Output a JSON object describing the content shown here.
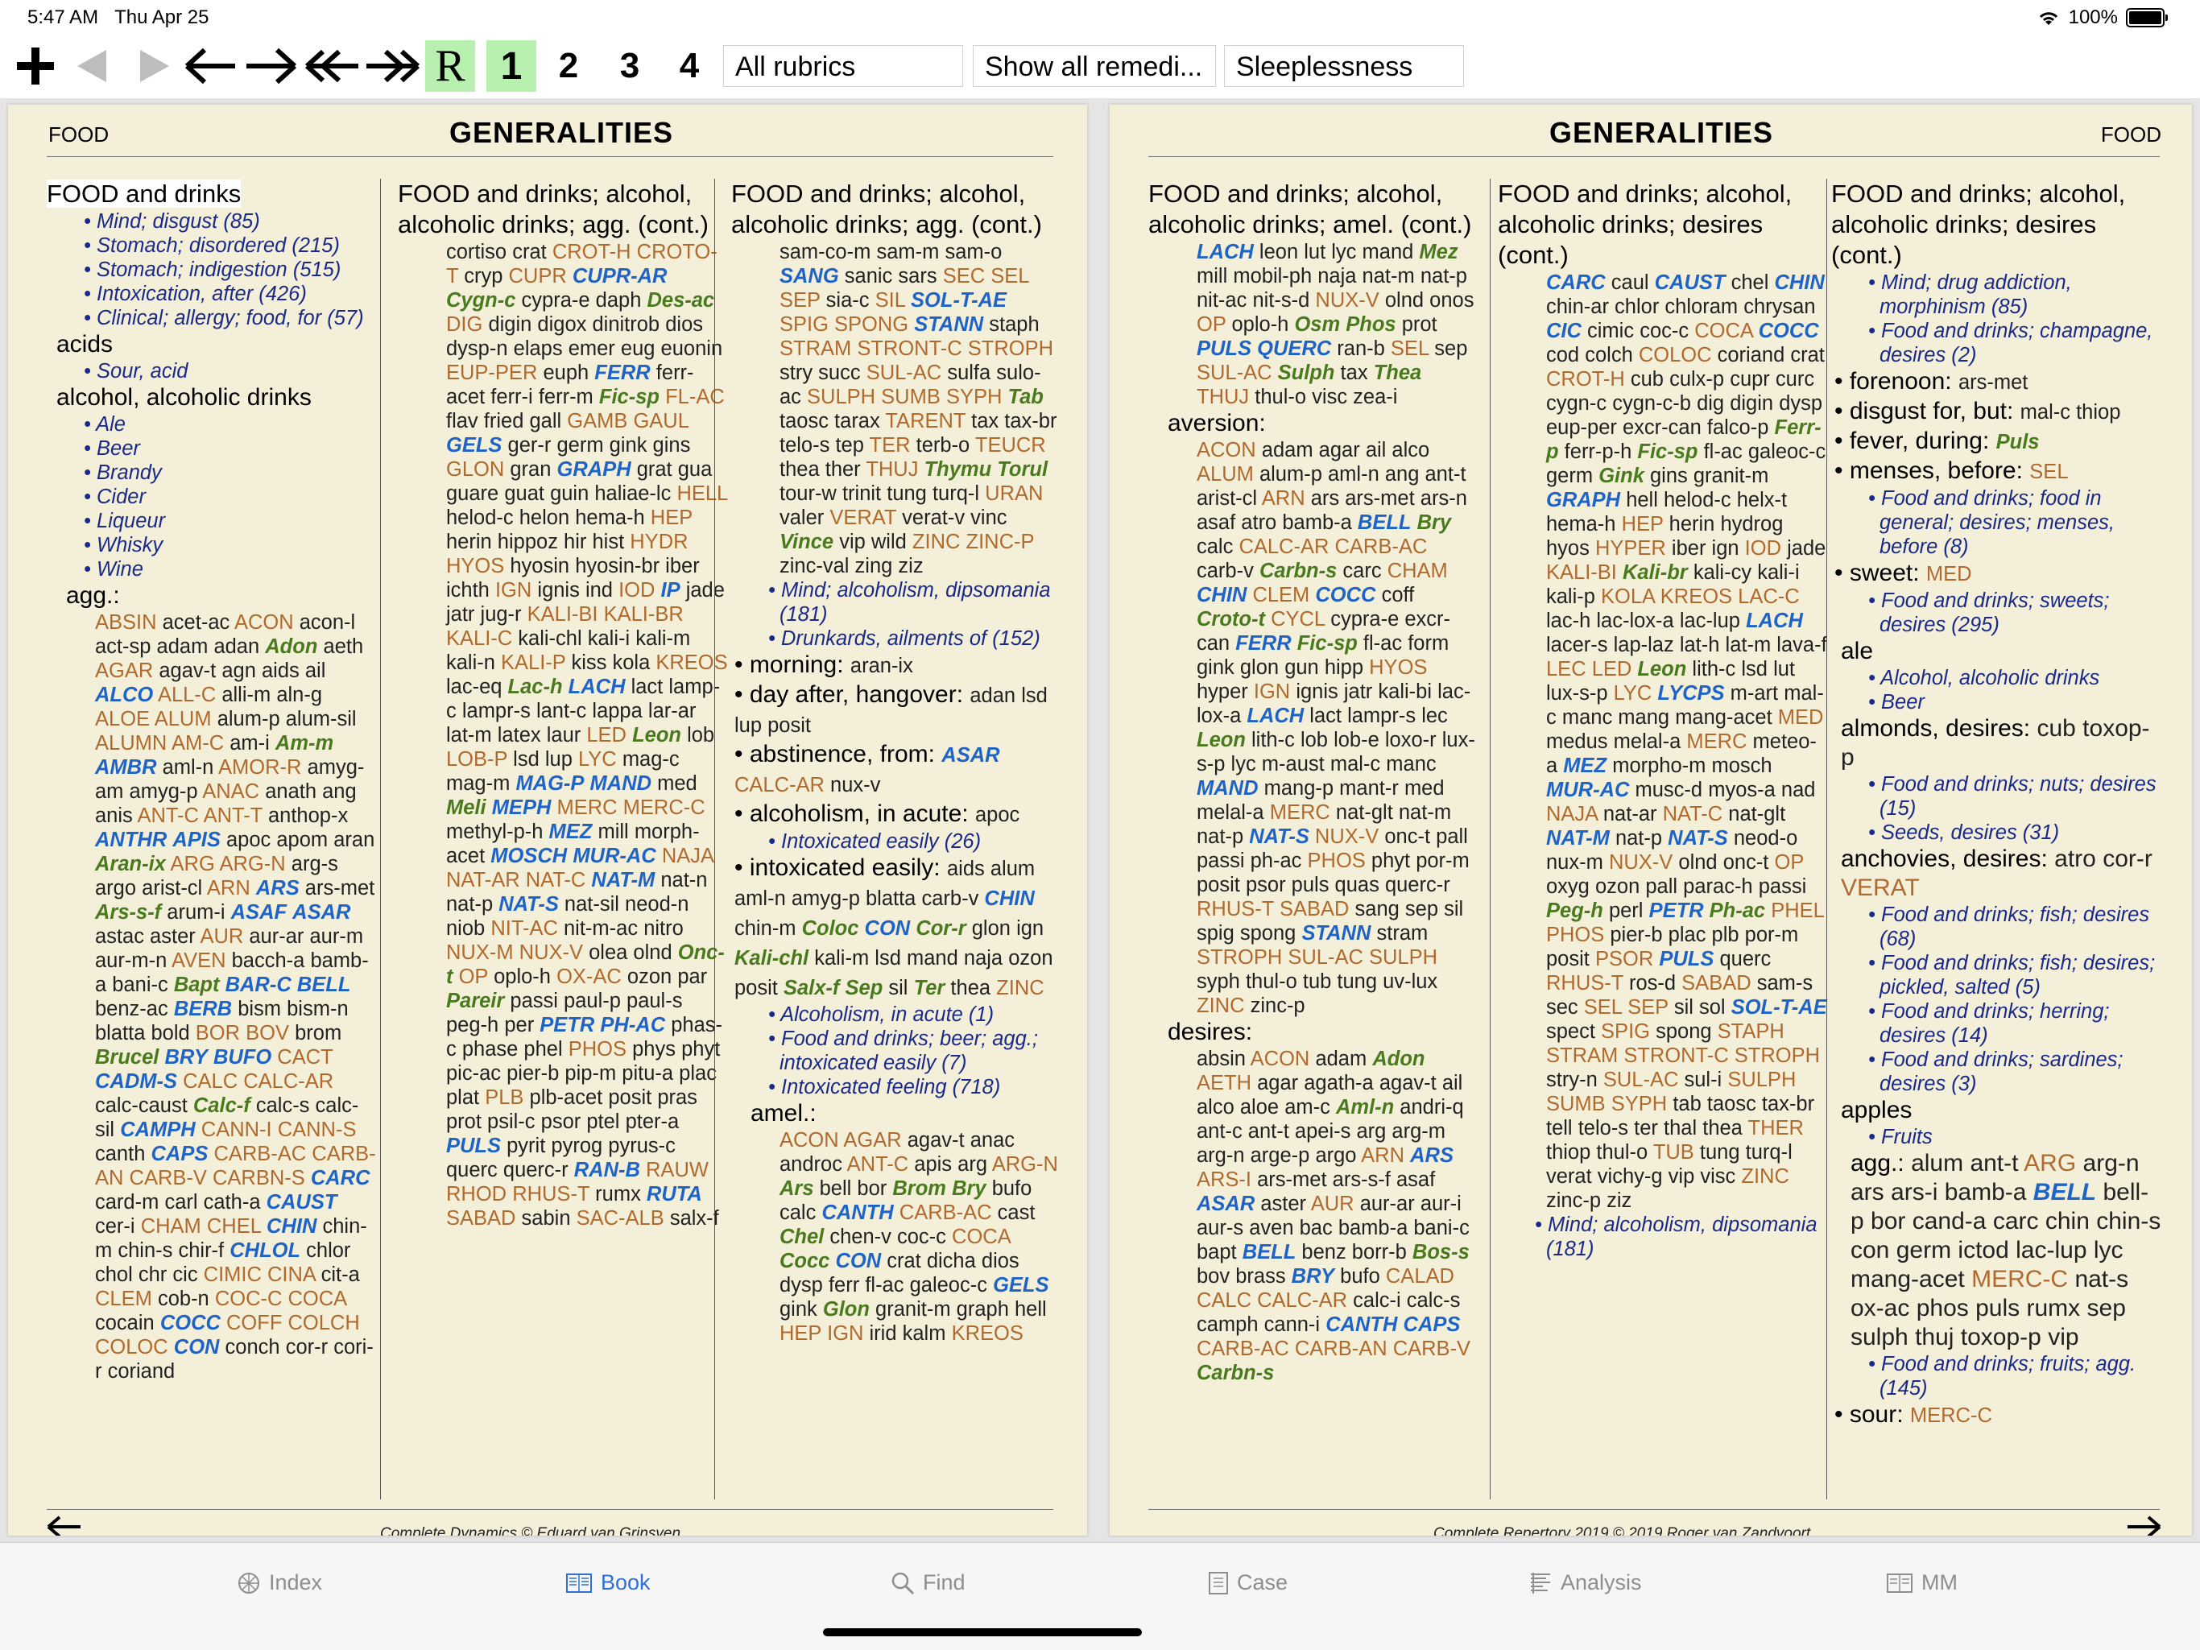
{
  "status": {
    "time": "5:47 AM",
    "date": "Thu Apr 25",
    "battery": "100%"
  },
  "toolbar": {
    "buttons": [
      "R",
      "1",
      "2",
      "3",
      "4"
    ],
    "filter_rubrics": "All rubrics",
    "filter_remedies": "Show all remedi...",
    "search_field": "Sleeplessness"
  },
  "left_page": {
    "running_head": "FOOD",
    "title": "GENERALITIES",
    "footer": "Complete Dynamics © Eduard van Grinsven",
    "col1": [
      {
        "k": "h",
        "t": "FOOD and drinks",
        "hl": true
      },
      {
        "k": "x",
        "t": "Mind; disgust (85)"
      },
      {
        "k": "x",
        "t": "Stomach; disordered (215)"
      },
      {
        "k": "x",
        "t": "Stomach; indigestion (515)"
      },
      {
        "k": "x",
        "t": "Intoxication, after (426)"
      },
      {
        "k": "x",
        "t": "Clinical; allergy; food, for (57)"
      },
      {
        "k": "s",
        "t": "acids"
      },
      {
        "k": "x",
        "t": "Sour, acid"
      },
      {
        "k": "s",
        "t": "alcohol, alcoholic drinks"
      },
      {
        "k": "x",
        "t": "Ale"
      },
      {
        "k": "x",
        "t": "Beer"
      },
      {
        "k": "x",
        "t": "Brandy"
      },
      {
        "k": "x",
        "t": "Cider"
      },
      {
        "k": "x",
        "t": "Liqueur"
      },
      {
        "k": "x",
        "t": "Whisky"
      },
      {
        "k": "x",
        "t": "Wine"
      },
      {
        "k": "s2",
        "t": "agg.: "
      },
      {
        "k": "r",
        "t": "ABSIN acet-ac ACON acon-l act-sp adam adan Adon aeth AGAR agav-t agn aids ail ALCO ALL-C alli-m aln-g ALOE ALUM alum-p alum-sil ALUMN AM-C am-i Am-m AMBR aml-n AMOR-R amyg-am amyg-p ANAC anath ang anis ANT-C ANT-T anthop-x ANTHR APIS apoc apom aran Aran-ix ARG ARG-N arg-s argo arist-cl ARN ARS ars-met Ars-s-f arum-i ASAF ASAR astac aster AUR aur-ar aur-m aur-m-n AVEN bacch-a bamb-a bani-c Bapt BAR-C BELL benz-ac BERB bism bism-n blatta bold BOR BOV brom Brucel BRY BUFO CACT CADM-S CALC CALC-AR calc-caust Calc-f calc-s calc-sil CAMPH CANN-I CANN-S canth CAPS CARB-AC CARB-AN CARB-V CARBN-S CARC card-m carl cath-a CAUST cer-i CHAM CHEL CHIN chin-m chin-s chir-f CHLOL chlor chol chr cic CIMIC CINA cit-a CLEM cob-n COC-C COCA cocain COCC COFF COLCH COLOC CON conch cor-r cori-r coriand"
      }
    ],
    "col2": [
      {
        "k": "h",
        "t": "FOOD and drinks; alcohol, alcoholic drinks; agg. (cont.)"
      },
      {
        "k": "r",
        "t": "cortiso crat CROT-H CROTO-T cryp CUPR CUPR-AR Cygn-c cypra-e daph Des-ac DIG digin digox dinitrob dios dysp-n elaps emer eug euonin EUP-PER euph FERR ferr-acet ferr-i ferr-m Fic-sp FL-AC flav fried gall GAMB GAUL GELS ger-r germ gink gins GLON gran GRAPH grat gua guare guat guin haliae-lc HELL helod-c helon hema-h HEP herin hippoz hir hist HYDR HYOS hyosin hyosin-br iber ichth IGN ignis ind IOD IP jade jatr jug-r KALI-BI KALI-BR KALI-C kali-chl kali-i kali-m kali-n KALI-P kiss kola KREOS lac-eq Lac-h LACH lact lamp-c lampr-s lant-c lappa lar-ar lat-m latex laur LED Leon lob LOB-P lsd lup LYC mag-c mag-m MAG-P MAND med Meli MEPH MERC MERC-C methyl-p-h MEZ mill morph-acet MOSCH MUR-AC NAJA NAT-AR NAT-C NAT-M nat-n nat-p NAT-S nat-sil neod-n niob NIT-AC nit-m-ac nitro NUX-M NUX-V olea olnd Onc-t OP oplo-h OX-AC ozon par Pareir passi paul-p paul-s peg-h per PETR PH-AC phas-c phase phel PHOS phys phyt pic-ac pier-b pip-m pitu-a plac plat PLB plb-acet posit pras prot psil-c psor ptel pter-a PULS pyrit pyrog pyrus-c querc querc-r RAN-B RAUW RHOD RHUS-T rumx RUTA SABAD sabin SAC-ALB salx-f"
      }
    ],
    "col3": [
      {
        "k": "h",
        "t": "FOOD and drinks; alcohol, alcoholic drinks; agg. (cont.)"
      },
      {
        "k": "r",
        "t": "sam-co-m sam-m sam-o SANG sanic sars SEC SEL SEP sia-c SIL SOL-T-AE SPIG SPONG STANN staph STRAM STRONT-C STROPH stry succ SUL-AC sulfa sulo-ac SULPH SUMB SYPH Tab taosc tarax TARENT tax tax-br telo-s tep TER terb-o TEUCR thea ther THUJ Thymu Torul tour-w trinit tung turq-l URAN valer VERAT verat-v vinc Vince vip wild ZINC ZINC-P zinc-val zing ziz"
      },
      {
        "k": "x",
        "t": "Mind; alcoholism, dipsomania (181)"
      },
      {
        "k": "x",
        "t": "Drunkards, ailments of (152)"
      },
      {
        "k": "b",
        "t": "morning: ",
        "r": "aran-ix"
      },
      {
        "k": "b",
        "t": "day after, hangover: ",
        "r": "adan lsd lup posit"
      },
      {
        "k": "b",
        "t": "abstinence, from: ",
        "r": "ASAR CALC-AR nux-v"
      },
      {
        "k": "b",
        "t": "alcoholism, in acute: ",
        "r": "apoc"
      },
      {
        "k": "x",
        "t": "Intoxicated easily (26)"
      },
      {
        "k": "b",
        "t": "intoxicated easily: ",
        "r": "aids alum aml-n amyg-p blatta carb-v CHIN chin-m Coloc CON Cor-r glon ign Kali-chl kali-m lsd mand naja ozon posit Salx-f Sep sil Ter thea ZINC"
      },
      {
        "k": "x",
        "t": "Alcoholism, in acute (1)"
      },
      {
        "k": "x",
        "t": "Food and drinks; beer; agg.; intoxicated easily (7)"
      },
      {
        "k": "x",
        "t": "Intoxicated feeling (718)"
      },
      {
        "k": "s2",
        "t": "amel.: "
      },
      {
        "k": "r",
        "t": "ACON AGAR agav-t anac androc ANT-C apis arg ARG-N Ars bell bor Brom Bry bufo calc CANTH CARB-AC cast Chel chen-v coc-c COCA Cocc CON crat dicha dios dysp ferr fl-ac galeoc-c GELS gink Glon granit-m graph hell HEP IGN irid kalm KREOS"
      }
    ]
  },
  "right_page": {
    "running_head": "FOOD",
    "title": "GENERALITIES",
    "footer": "Complete Repertory 2019 © 2019 Roger van Zandvoort",
    "col1": [
      {
        "k": "h",
        "t": "FOOD and drinks; alcohol, alcoholic drinks; amel. (cont.)"
      },
      {
        "k": "r",
        "t": "LACH leon lut lyc mand Mez mill mobil-ph naja nat-m nat-p nit-ac nit-s-d NUX-V olnd onos OP oplo-h Osm Phos prot PULS QUERC ran-b SEL sep SUL-AC Sulph tax Thea THUJ thul-o visc zea-i"
      },
      {
        "k": "s2",
        "t": "aversion: "
      },
      {
        "k": "r",
        "t": "ACON adam agar ail alco ALUM alum-p aml-n ang ant-t arist-cl ARN ars ars-met ars-n asaf atro bamb-a BELL Bry calc CALC-AR CARB-AC carb-v Carbn-s carc CHAM CHIN CLEM COCC coff Croto-t CYCL cypra-e excr-can FERR Fic-sp fl-ac form gink glon gun hipp HYOS hyper IGN ignis jatr kali-bi lac-lox-a LACH lact lampr-s lec Leon lith-c lob lob-e loxo-r lux-s-p lyc m-aust mal-c manc MAND mang-p mant-r med melal-a MERC nat-glt nat-m nat-p NAT-S NUX-V onc-t pall passi ph-ac PHOS phyt por-m posit psor puls quas querc-r RHUS-T SABAD sang sep sil spig spong STANN stram STROPH SUL-AC SULPH syph thul-o tub tung uv-lux ZINC zinc-p"
      },
      {
        "k": "s2",
        "t": "desires: "
      },
      {
        "k": "r",
        "t": "absin ACON adam Adon AETH agar agath-a agav-t ail alco aloe am-c Aml-n andri-q ant-c ant-t apei-s arg arg-m arg-n arge-p argo ARN ARS ARS-I ars-met ars-s-f asaf ASAR aster AUR aur-ar aur-i aur-s aven bac bamb-a bani-c bapt BELL benz borr-b Bos-s bov brass BRY bufo CALAD CALC CALC-AR calc-i calc-s camph cann-i CANTH CAPS CARB-AC CARB-AN CARB-V Carbn-s"
      }
    ],
    "col2": [
      {
        "k": "h",
        "t": "FOOD and drinks; alcohol, alcoholic drinks; desires (cont.)"
      },
      {
        "k": "r",
        "t": "CARC caul CAUST chel CHIN chin-ar chlor chloram chrysan CIC cimic coc-c COCA COCC cod colch COLOC coriand crat CROT-H cub culx-p cupr curc cygn-c cygn-c-b dig digin dysp eup-per excr-can falco-p Ferr-p ferr-p-h Fic-sp fl-ac galeoc-c germ Gink gins granit-m GRAPH hell helod-c helx-t hema-h HEP herin hydrog hyos HYPER iber ign IOD jade KALI-BI Kali-br kali-cy kali-i kali-p KOLA KREOS LAC-C lac-h lac-lox-a lac-lup LACH lacer-s lap-laz lat-h lat-m lava-f LEC LED Leon lith-c lsd lut lux-s-p LYC LYCPS m-art mal-c manc mang mang-acet MED medus melal-a MERC meteo-a MEZ morpho-m mosch MUR-AC musc-d myos-a nad NAJA nat-ar NAT-C nat-glt NAT-M nat-p NAT-S neod-o nux-m NUX-V olnd onc-t OP oxyg ozon pall parac-h passi Peg-h perl PETR Ph-ac PHEL PHOS pier-b plac plb por-m posit PSOR PULS querc RHUS-T ros-d SABAD sam-s sec SEL SEP sil sol SOL-T-AE spect SPIG spong STAPH STRAM STRONT-C STROPH stry-n SUL-AC sul-i SULPH SUMB SYPH tab taosc tax-br tell telo-s ter thal thea THER thiop thul-o TUB tung turq-l verat vichy-g vip visc ZINC zinc-p ziz"
      },
      {
        "k": "x",
        "t": "Mind; alcoholism, dipsomania (181)"
      }
    ],
    "col3": [
      {
        "k": "h",
        "t": "FOOD and drinks; alcohol, alcoholic drinks; desires (cont.)"
      },
      {
        "k": "x",
        "t": "Mind; drug addiction, morphinism (85)"
      },
      {
        "k": "x",
        "t": "Food and drinks; champagne, desires (2)"
      },
      {
        "k": "b",
        "t": "forenoon: ",
        "r": "ars-met"
      },
      {
        "k": "b",
        "t": "disgust for, but: ",
        "r": "mal-c thiop"
      },
      {
        "k": "b",
        "t": "fever, during: ",
        "r": "Puls"
      },
      {
        "k": "b",
        "t": "menses, before: ",
        "r": "SEL"
      },
      {
        "k": "x",
        "t": "Food and drinks; food in general; desires; menses, before (8)"
      },
      {
        "k": "b",
        "t": "sweet: ",
        "r": "MED"
      },
      {
        "k": "x",
        "t": "Food and drinks; sweets; desires (295)"
      },
      {
        "k": "s",
        "t": "ale"
      },
      {
        "k": "x",
        "t": "Alcohol, alcoholic drinks"
      },
      {
        "k": "x",
        "t": "Beer"
      },
      {
        "k": "s",
        "t": "almonds, desires: ",
        "r": "cub toxop-p"
      },
      {
        "k": "x",
        "t": "Food and drinks; nuts; desires (15)"
      },
      {
        "k": "x",
        "t": "Seeds, desires (31)"
      },
      {
        "k": "s",
        "t": "anchovies, desires: ",
        "r": "atro cor-r VERAT"
      },
      {
        "k": "x",
        "t": "Food and drinks; fish; desires (68)"
      },
      {
        "k": "x",
        "t": "Food and drinks; fish; desires; pickled, salted (5)"
      },
      {
        "k": "x",
        "t": "Food and drinks; herring; desires (14)"
      },
      {
        "k": "x",
        "t": "Food and drinks; sardines; desires (3)"
      },
      {
        "k": "s",
        "t": "apples"
      },
      {
        "k": "x",
        "t": "Fruits"
      },
      {
        "k": "s2",
        "t": "agg.: ",
        "r": "alum ant-t ARG arg-n ars ars-i bamb-a BELL bell-p bor cand-a carc chin chin-s con germ ictod lac-lup lyc mang-acet MERC-C nat-s ox-ac phos puls rumx sep sulph thuj toxop-p vip"
      },
      {
        "k": "x",
        "t": "Food and drinks; fruits; agg. (145)"
      },
      {
        "k": "b",
        "t": "sour: ",
        "r": "MERC-C"
      }
    ]
  },
  "grade_colors": {
    "r1": "#222222",
    "r2": "#b06a2e",
    "r3": "#1e64c8",
    "r4": "#4a7a1e"
  },
  "tabs": [
    {
      "label": "Index",
      "icon": "index-icon",
      "active": false
    },
    {
      "label": "Book",
      "icon": "book-icon",
      "active": true
    },
    {
      "label": "Find",
      "icon": "search-icon",
      "active": false
    },
    {
      "label": "Case",
      "icon": "case-icon",
      "active": false
    },
    {
      "label": "Analysis",
      "icon": "analysis-icon",
      "active": false
    },
    {
      "label": "MM",
      "icon": "materia-medica-icon",
      "active": false
    }
  ]
}
